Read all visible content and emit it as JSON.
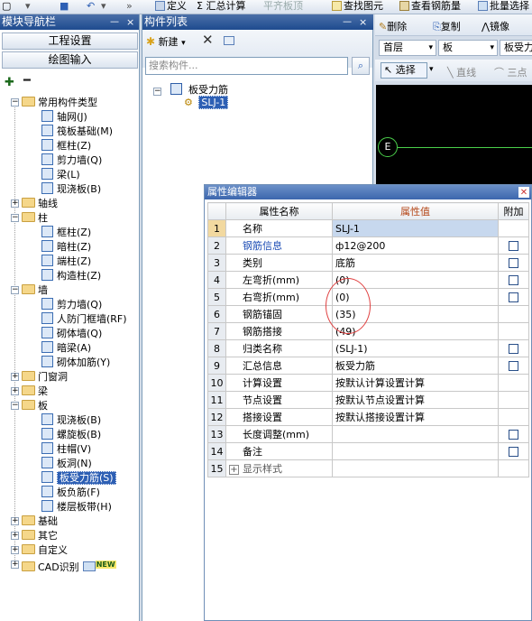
{
  "toolbar": {
    "define": "定义",
    "summary": "Σ 汇总计算",
    "level_slab": "平齐板顶",
    "find_element": "查找图元",
    "view_rebar": "查看钢筋量",
    "batch_select": "批量选择"
  },
  "nav": {
    "title": "模块导航栏",
    "pin": "ᅳ",
    "close": "×",
    "engineering_settings": "工程设置",
    "drawing_input": "绘图输入",
    "tree": [
      {
        "label": "常用构件类型",
        "type": "folder",
        "level": 0,
        "expanded": true
      },
      {
        "label": "轴网(J)",
        "type": "item",
        "level": 1
      },
      {
        "label": "筏板基础(M)",
        "type": "item",
        "level": 1
      },
      {
        "label": "框柱(Z)",
        "type": "item",
        "level": 1
      },
      {
        "label": "剪力墙(Q)",
        "type": "item",
        "level": 1
      },
      {
        "label": "梁(L)",
        "type": "item",
        "level": 1
      },
      {
        "label": "现浇板(B)",
        "type": "item",
        "level": 1
      },
      {
        "label": "轴线",
        "type": "folder",
        "level": 0,
        "expanded": false
      },
      {
        "label": "柱",
        "type": "folder",
        "level": 0,
        "expanded": true
      },
      {
        "label": "框柱(Z)",
        "type": "item",
        "level": 1
      },
      {
        "label": "暗柱(Z)",
        "type": "item",
        "level": 1
      },
      {
        "label": "端柱(Z)",
        "type": "item",
        "level": 1
      },
      {
        "label": "构造柱(Z)",
        "type": "item",
        "level": 1
      },
      {
        "label": "墙",
        "type": "folder",
        "level": 0,
        "expanded": true
      },
      {
        "label": "剪力墙(Q)",
        "type": "item",
        "level": 1
      },
      {
        "label": "人防门框墙(RF)",
        "type": "item",
        "level": 1
      },
      {
        "label": "砌体墙(Q)",
        "type": "item",
        "level": 1
      },
      {
        "label": "暗梁(A)",
        "type": "item",
        "level": 1
      },
      {
        "label": "砌体加筋(Y)",
        "type": "item",
        "level": 1
      },
      {
        "label": "门窗洞",
        "type": "folder",
        "level": 0,
        "expanded": false
      },
      {
        "label": "梁",
        "type": "folder",
        "level": 0,
        "expanded": false
      },
      {
        "label": "板",
        "type": "folder",
        "level": 0,
        "expanded": true
      },
      {
        "label": "现浇板(B)",
        "type": "item",
        "level": 1
      },
      {
        "label": "螺旋板(B)",
        "type": "item",
        "level": 1
      },
      {
        "label": "柱帽(V)",
        "type": "item",
        "level": 1
      },
      {
        "label": "板洞(N)",
        "type": "item",
        "level": 1
      },
      {
        "label": "板受力筋(S)",
        "type": "item",
        "level": 1,
        "selected": true
      },
      {
        "label": "板负筋(F)",
        "type": "item",
        "level": 1
      },
      {
        "label": "楼层板带(H)",
        "type": "item",
        "level": 1
      },
      {
        "label": "基础",
        "type": "folder",
        "level": 0,
        "expanded": false
      },
      {
        "label": "其它",
        "type": "folder",
        "level": 0,
        "expanded": false
      },
      {
        "label": "自定义",
        "type": "folder",
        "level": 0,
        "expanded": false
      },
      {
        "label": "CAD识别",
        "type": "folder",
        "level": 0,
        "expanded": false,
        "badge": "NEW"
      }
    ]
  },
  "component_list": {
    "title": "构件列表",
    "new_label": "新建",
    "search_placeholder": "搜索构件...",
    "root": "板受力筋",
    "child": "SLJ-1"
  },
  "right_toolbar": {
    "delete": "删除",
    "copy": "复制",
    "mirror": "镜像",
    "floor": "首层",
    "category": "板",
    "type": "板受力",
    "select": "选择",
    "line": "直线",
    "three_point": "三点"
  },
  "canvas": {
    "axis_label": "E"
  },
  "property_editor": {
    "title": "属性编辑器",
    "headers": {
      "num": "",
      "name": "属性名称",
      "value": "属性值",
      "attach": "附加"
    },
    "rows": [
      {
        "num": "1",
        "name": "名称",
        "value": "SLJ-1",
        "checkbox": false,
        "name_color": "normal"
      },
      {
        "num": "2",
        "name": "钢筋信息",
        "value": "ф12@200",
        "checkbox": true,
        "name_color": "blue"
      },
      {
        "num": "3",
        "name": "类别",
        "value": "底筋",
        "checkbox": true,
        "name_color": "normal"
      },
      {
        "num": "4",
        "name": "左弯折(mm)",
        "value": "(0)",
        "checkbox": true,
        "name_color": "normal"
      },
      {
        "num": "5",
        "name": "右弯折(mm)",
        "value": "(0)",
        "checkbox": true,
        "name_color": "normal"
      },
      {
        "num": "6",
        "name": "钢筋锚固",
        "value": "(35)",
        "checkbox": false,
        "name_color": "normal"
      },
      {
        "num": "7",
        "name": "钢筋搭接",
        "value": "(49)",
        "checkbox": false,
        "name_color": "normal"
      },
      {
        "num": "8",
        "name": "归类名称",
        "value": "(SLJ-1)",
        "checkbox": true,
        "name_color": "normal"
      },
      {
        "num": "9",
        "name": "汇总信息",
        "value": "板受力筋",
        "checkbox": true,
        "name_color": "normal"
      },
      {
        "num": "10",
        "name": "计算设置",
        "value": "按默认计算设置计算",
        "checkbox": false,
        "name_color": "normal"
      },
      {
        "num": "11",
        "name": "节点设置",
        "value": "按默认节点设置计算",
        "checkbox": false,
        "name_color": "normal"
      },
      {
        "num": "12",
        "name": "搭接设置",
        "value": "按默认搭接设置计算",
        "checkbox": false,
        "name_color": "normal"
      },
      {
        "num": "13",
        "name": "长度调整(mm)",
        "value": "",
        "checkbox": true,
        "name_color": "normal"
      },
      {
        "num": "14",
        "name": "备注",
        "value": "",
        "checkbox": true,
        "name_color": "normal"
      },
      {
        "num": "15",
        "name": "显示样式",
        "value": "",
        "checkbox": false,
        "name_color": "gray",
        "expander": true
      }
    ]
  },
  "colors": {
    "selection": "#2d5fb4",
    "header_gradient": "#1e4b8f",
    "annotation_circle": "#e04040",
    "value_header": "#b5481a"
  }
}
